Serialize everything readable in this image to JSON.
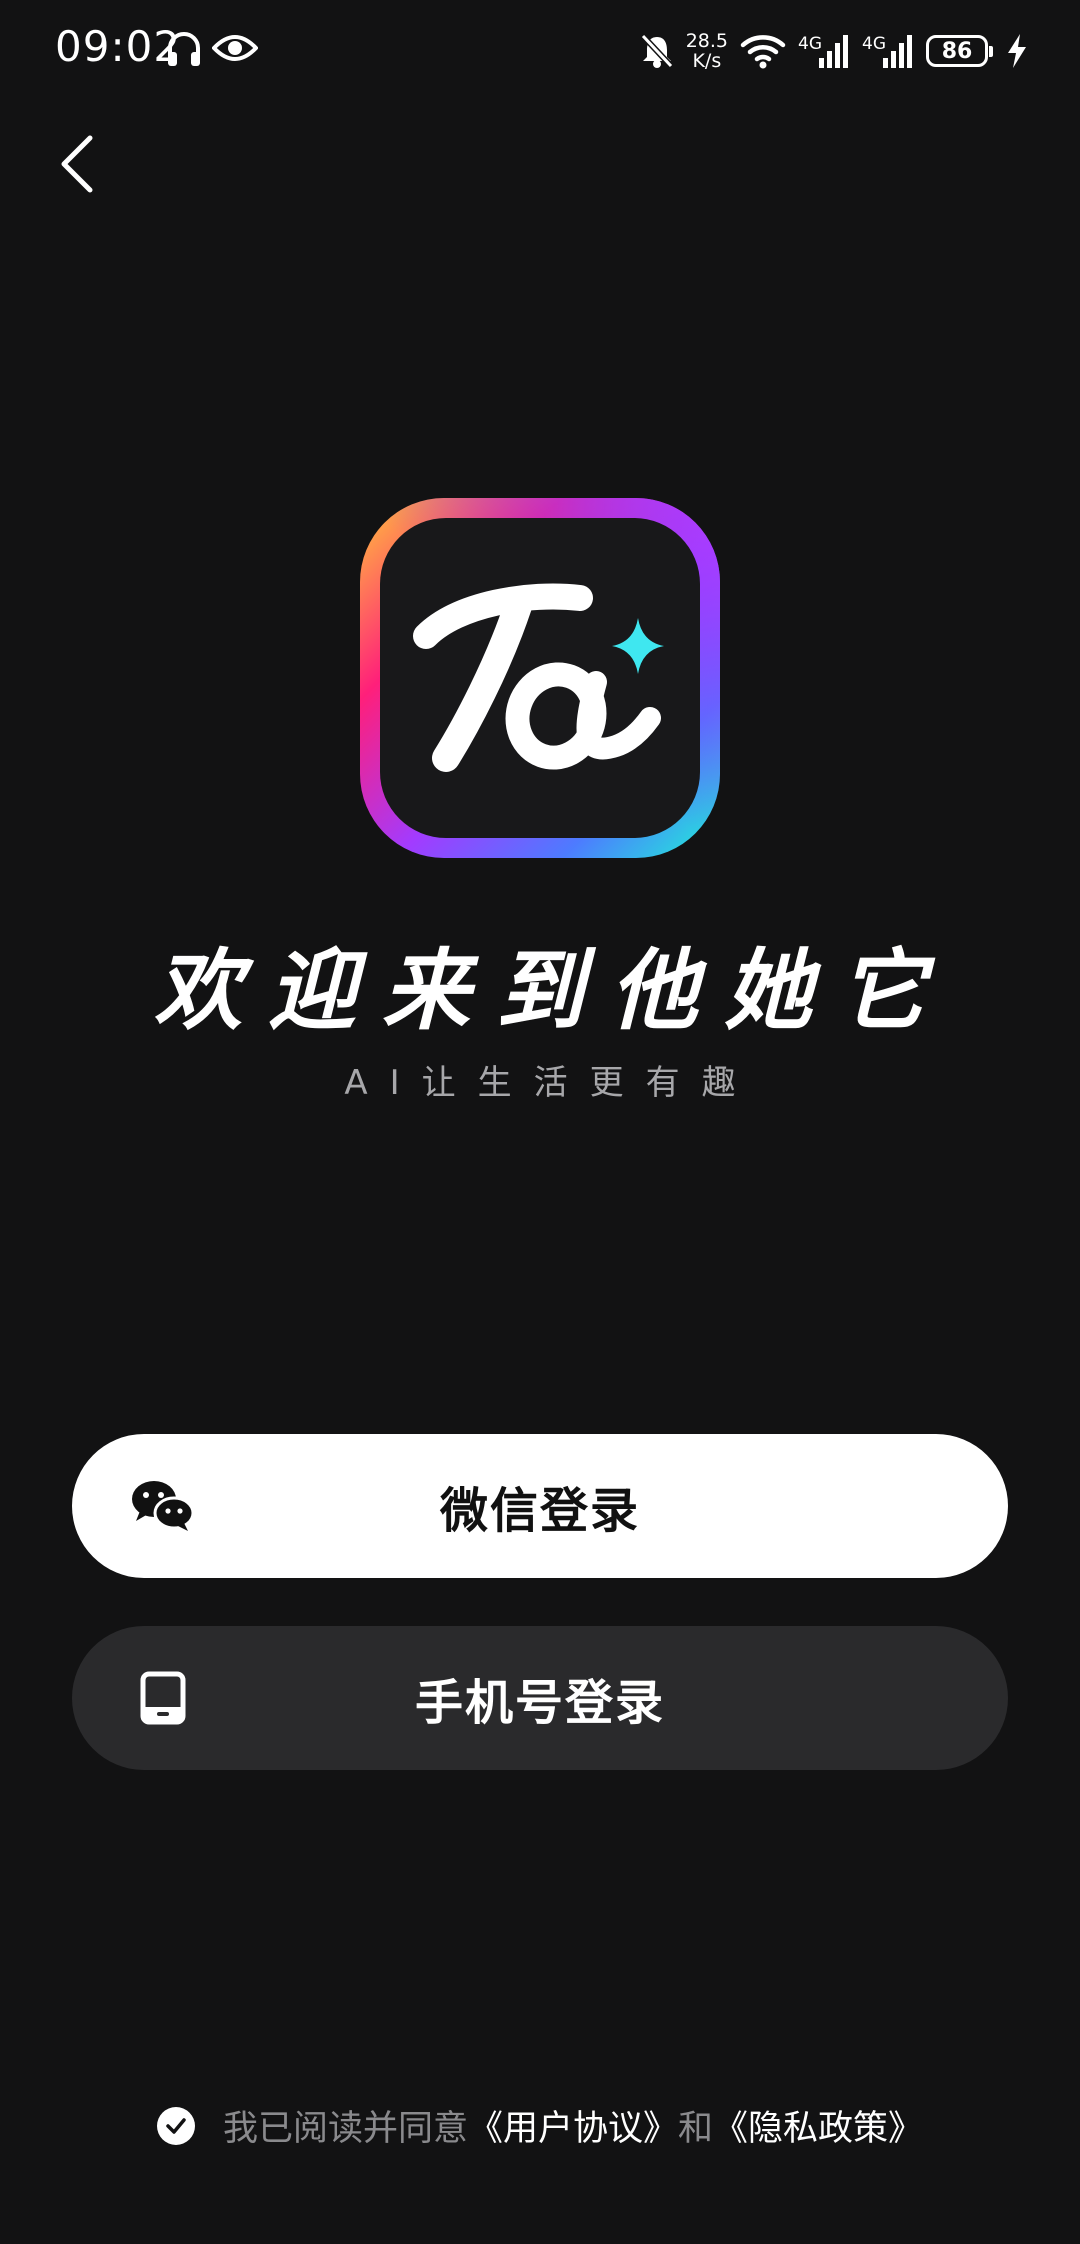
{
  "status_bar": {
    "time": "09:02",
    "net_speed_value": "28.5",
    "net_speed_unit": "K/s",
    "signal1_label": "4G",
    "signal2_label": "4G",
    "battery": "86",
    "icons": [
      "headphone-icon",
      "eye-icon",
      "bell-muted-icon",
      "wifi-icon",
      "signal-icon",
      "battery-icon",
      "charging-icon"
    ]
  },
  "header": {
    "back_icon": "chevron-left-icon"
  },
  "brand": {
    "logo_text": "Ta",
    "title": "欢迎来到他她它",
    "subtitle": "AI让生活更有趣"
  },
  "login": {
    "wechat_label": "微信登录",
    "wechat_icon": "wechat-icon",
    "phone_label": "手机号登录",
    "phone_icon": "phone-icon"
  },
  "agreement": {
    "checked": true,
    "prefix": "我已阅读并同意",
    "user_agreement": "《用户协议》",
    "conjunction": "和",
    "privacy_policy": "《隐私政策》"
  },
  "colors": {
    "background": "#121213",
    "primary_button": "#ffffff",
    "secondary_button": "#2a2a2c",
    "muted_text": "#8a8a8d",
    "accent_cyan": "#3fe7f0"
  }
}
